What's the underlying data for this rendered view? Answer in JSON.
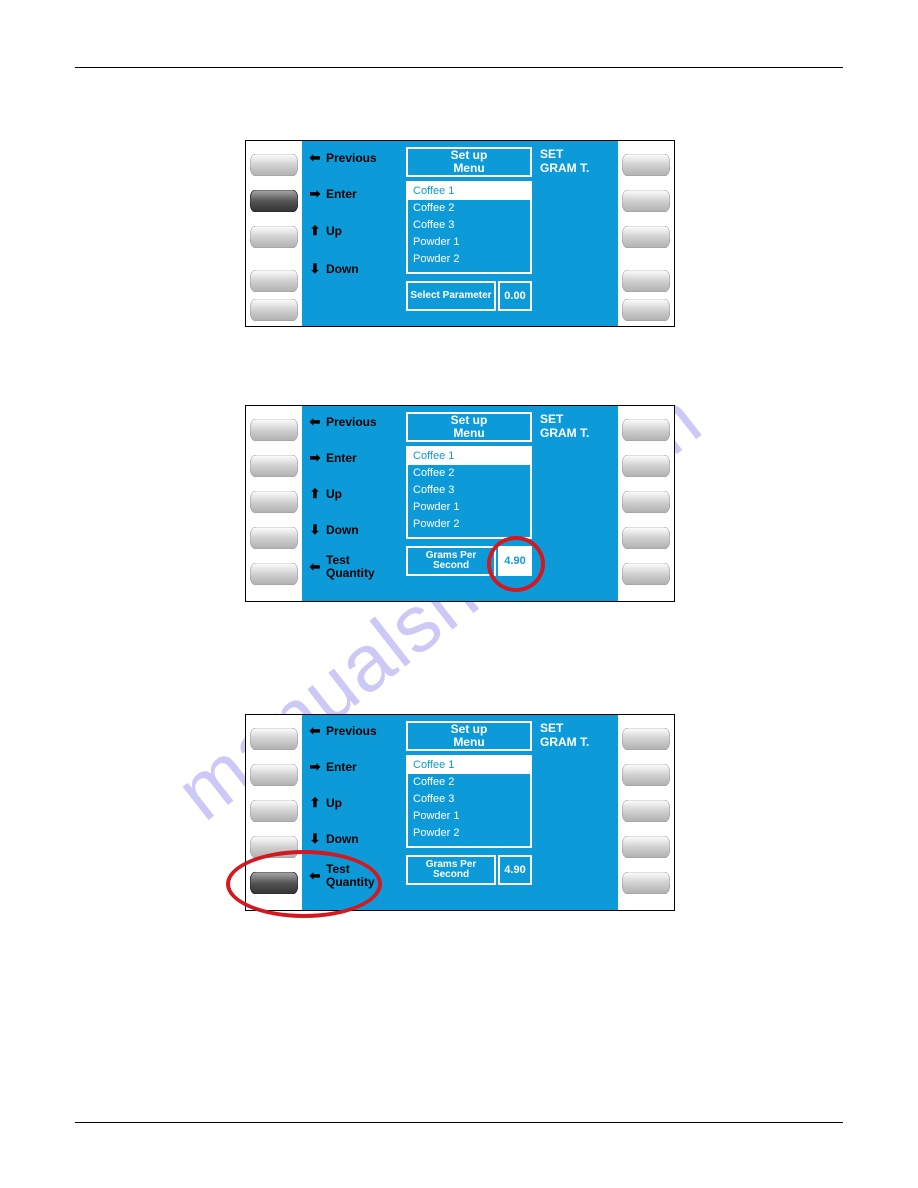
{
  "watermark": "manualshive.com",
  "common": {
    "nav": {
      "previous": "Previous",
      "enter": "Enter",
      "up": "Up",
      "down": "Down",
      "testQuantity": "Test\nQuantity"
    },
    "menuTitle": "Set up\nMenu",
    "rightTitle": "SET\nGRAM T.",
    "items": [
      "Coffee 1",
      "Coffee 2",
      "Coffee 3",
      "Powder 1",
      "Powder 2"
    ]
  },
  "panel1": {
    "paramLabel": "Select\nParameter",
    "value": "0.00"
  },
  "panel2": {
    "paramLabel": "Grams\nPer\nSecond",
    "value": "4.90"
  },
  "panel3": {
    "paramLabel": "Grams\nPer\nSecond",
    "value": "4.90"
  }
}
